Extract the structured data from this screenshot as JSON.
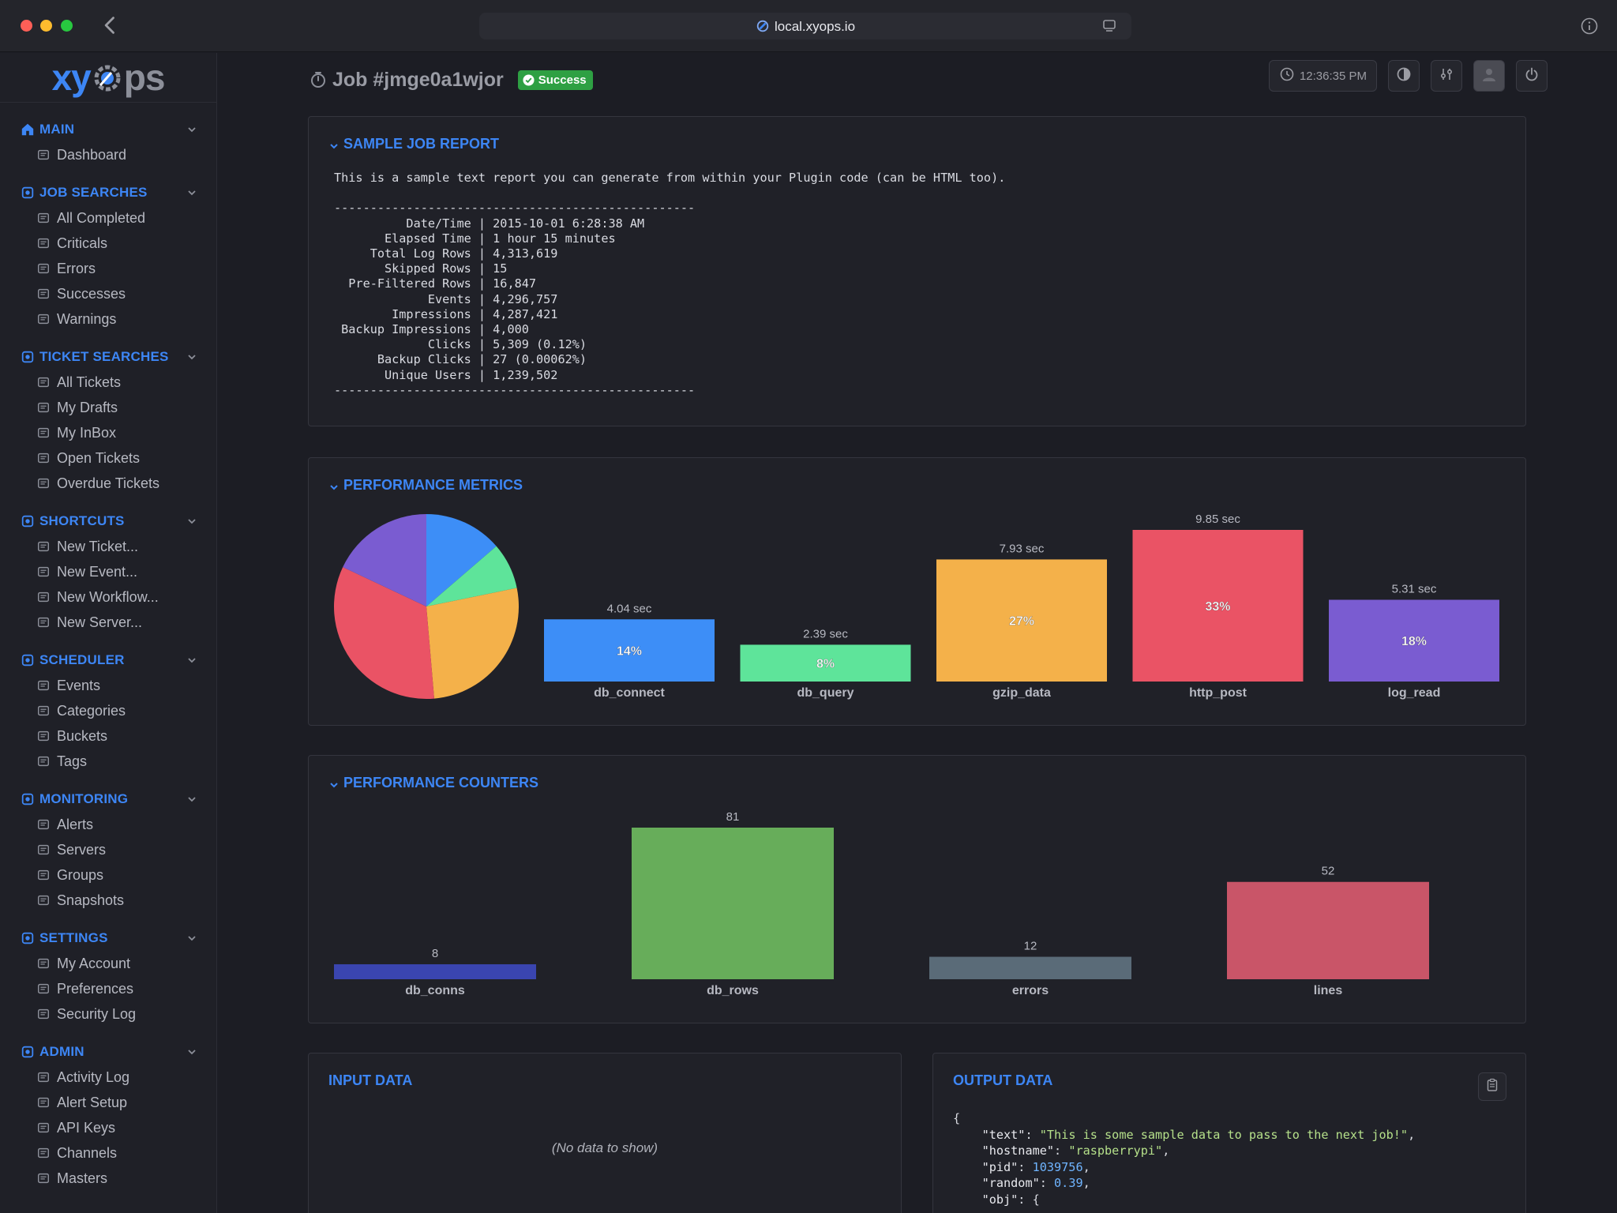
{
  "browser": {
    "url": "local.xyops.io"
  },
  "logo": {
    "left": "xy",
    "right": "ps"
  },
  "sidebar": {
    "sections": [
      {
        "title": "MAIN",
        "icon": "home-icon",
        "items": [
          {
            "label": "Dashboard",
            "icon": "dashboard-icon"
          }
        ]
      },
      {
        "title": "JOB SEARCHES",
        "icon": "user-search-icon",
        "items": [
          {
            "label": "All Completed",
            "icon": "cloud-check-icon"
          },
          {
            "label": "Criticals",
            "icon": "fire-icon"
          },
          {
            "label": "Errors",
            "icon": "alert-circle-icon"
          },
          {
            "label": "Successes",
            "icon": "check-circle-icon"
          },
          {
            "label": "Warnings",
            "icon": "warning-icon"
          }
        ]
      },
      {
        "title": "TICKET SEARCHES",
        "icon": "ticket-search-icon",
        "items": [
          {
            "label": "All Tickets",
            "icon": "tickets-icon"
          },
          {
            "label": "My Drafts",
            "icon": "dots-icon"
          },
          {
            "label": "My InBox",
            "icon": "inbox-icon"
          },
          {
            "label": "Open Tickets",
            "icon": "open-ticket-icon"
          },
          {
            "label": "Overdue Tickets",
            "icon": "calendar-alert-icon"
          }
        ]
      },
      {
        "title": "SHORTCUTS",
        "icon": "hand-pointer-icon",
        "items": [
          {
            "label": "New Ticket...",
            "icon": "new-ticket-icon"
          },
          {
            "label": "New Event...",
            "icon": "new-event-icon"
          },
          {
            "label": "New Workflow...",
            "icon": "new-workflow-icon"
          },
          {
            "label": "New Server...",
            "icon": "new-server-icon"
          }
        ]
      },
      {
        "title": "SCHEDULER",
        "icon": "calendar-icon",
        "items": [
          {
            "label": "Events",
            "icon": "events-icon"
          },
          {
            "label": "Categories",
            "icon": "folder-icon"
          },
          {
            "label": "Buckets",
            "icon": "bucket-icon"
          },
          {
            "label": "Tags",
            "icon": "tag-icon"
          }
        ]
      },
      {
        "title": "MONITORING",
        "icon": "monitor-icon",
        "items": [
          {
            "label": "Alerts",
            "icon": "alert-ring-icon"
          },
          {
            "label": "Servers",
            "icon": "server-icon"
          },
          {
            "label": "Groups",
            "icon": "group-icon"
          },
          {
            "label": "Snapshots",
            "icon": "snapshot-icon"
          }
        ]
      },
      {
        "title": "SETTINGS",
        "icon": "gears-icon",
        "items": [
          {
            "label": "My Account",
            "icon": "account-icon"
          },
          {
            "label": "Preferences",
            "icon": "sliders-icon"
          },
          {
            "label": "Security Log",
            "icon": "shield-icon"
          }
        ]
      },
      {
        "title": "ADMIN",
        "icon": "lock-icon",
        "items": [
          {
            "label": "Activity Log",
            "icon": "activity-log-icon"
          },
          {
            "label": "Alert Setup",
            "icon": "bell-icon"
          },
          {
            "label": "API Keys",
            "icon": "key-icon"
          },
          {
            "label": "Channels",
            "icon": "megaphone-icon"
          },
          {
            "label": "Masters",
            "icon": "database-icon"
          }
        ]
      }
    ]
  },
  "header": {
    "title": "Job #jmge0a1wjor",
    "status": "Success",
    "clock": "12:36:35 PM"
  },
  "report_panel": {
    "title": "SAMPLE JOB REPORT",
    "intro": "This is a sample text report you can generate from within your Plugin code (can be HTML too).",
    "rule": "--------------------------------------------------",
    "rows": [
      {
        "label": "Date/Time",
        "value": "2015-10-01 6:28:38 AM"
      },
      {
        "label": "Elapsed Time",
        "value": "1 hour 15 minutes"
      },
      {
        "label": "Total Log Rows",
        "value": "4,313,619"
      },
      {
        "label": "Skipped Rows",
        "value": "15"
      },
      {
        "label": "Pre-Filtered Rows",
        "value": "16,847"
      },
      {
        "label": "Events",
        "value": "4,296,757"
      },
      {
        "label": "Impressions",
        "value": "4,287,421"
      },
      {
        "label": "Backup Impressions",
        "value": "4,000"
      },
      {
        "label": "Clicks",
        "value": "5,309 (0.12%)"
      },
      {
        "label": "Backup Clicks",
        "value": "27 (0.00062%)"
      },
      {
        "label": "Unique Users",
        "value": "1,239,502"
      }
    ]
  },
  "metrics_panel": {
    "title": "PERFORMANCE METRICS"
  },
  "counters_panel": {
    "title": "PERFORMANCE COUNTERS"
  },
  "input_panel": {
    "title": "INPUT DATA",
    "empty": "(No data to show)"
  },
  "output_panel": {
    "title": "OUTPUT DATA",
    "json_lines": [
      {
        "indent": 0,
        "text": "{"
      },
      {
        "indent": 1,
        "key": "\"text\"",
        "str": "\"This is some sample data to pass to the next job!\"",
        "tail": ","
      },
      {
        "indent": 1,
        "key": "\"hostname\"",
        "str": "\"raspberrypi\"",
        "tail": ","
      },
      {
        "indent": 1,
        "key": "\"pid\"",
        "num": "1039756",
        "tail": ","
      },
      {
        "indent": 1,
        "key": "\"random\"",
        "num": "0.39",
        "tail": ","
      },
      {
        "indent": 1,
        "key": "\"obj\"",
        "text": "{"
      }
    ]
  },
  "colors": {
    "accent": "#3d86f5",
    "success": "#2ea043"
  },
  "chart_data": [
    {
      "type": "bar",
      "title": "PERFORMANCE METRICS",
      "categories": [
        "db_connect",
        "db_query",
        "gzip_data",
        "http_post",
        "log_read"
      ],
      "values": [
        4.04,
        2.39,
        7.93,
        9.85,
        5.31
      ],
      "value_labels": [
        "4.04 sec",
        "2.39 sec",
        "7.93 sec",
        "9.85 sec",
        "5.31 sec"
      ],
      "percent_labels": [
        "14%",
        "8%",
        "27%",
        "33%",
        "18%"
      ],
      "colors": [
        "#3d8ef7",
        "#5ee49a",
        "#f4b14a",
        "#ea5365",
        "#7a5cd1"
      ],
      "ylim": [
        0,
        9.85
      ],
      "pie": {
        "type": "pie",
        "values": [
          4.04,
          2.39,
          7.93,
          9.85,
          5.31
        ],
        "colors": [
          "#3d8ef7",
          "#5ee49a",
          "#f4b14a",
          "#ea5365",
          "#7a5cd1"
        ]
      }
    },
    {
      "type": "bar",
      "title": "PERFORMANCE COUNTERS",
      "categories": [
        "db_conns",
        "db_rows",
        "errors",
        "lines"
      ],
      "values": [
        8,
        81,
        12,
        52
      ],
      "colors": [
        "#3a45b0",
        "#67ad5a",
        "#5a6b78",
        "#c95568"
      ],
      "ylim": [
        0,
        81
      ]
    }
  ]
}
